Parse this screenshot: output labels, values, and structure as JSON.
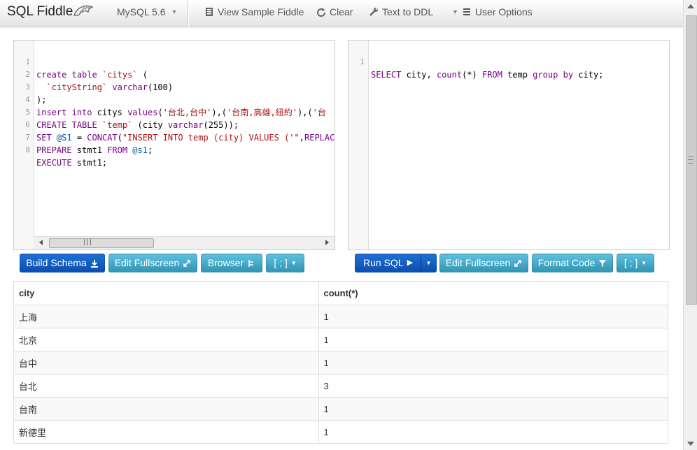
{
  "brand": {
    "title": "SQL Fiddle"
  },
  "nav": {
    "db_version": "MySQL 5.6",
    "view_sample": "View Sample Fiddle",
    "clear": "Clear",
    "text_to_ddl": "Text to DDL",
    "user_options": "User Options"
  },
  "schema_editor": {
    "line_numbers": [
      "1",
      "2",
      "3",
      "4",
      "5",
      "6",
      "7",
      "8"
    ],
    "lines": [
      "create table `citys` (",
      "  `cityString` varchar(100)",
      ");",
      "insert into citys values('台北,台中'),('台南,高雄,紐約'),('台",
      "CREATE TABLE `temp` (city varchar(255));",
      "SET @S1 = CONCAT(\"INSERT INTO temp (city) VALUES ('\",REPLAC",
      "PREPARE stmt1 FROM @s1;",
      "EXECUTE stmt1;"
    ]
  },
  "query_editor": {
    "line_numbers": [
      "1"
    ],
    "lines": [
      "SELECT city, count(*) FROM temp group by city;"
    ]
  },
  "schema_buttons": {
    "build": "Build Schema",
    "edit_fullscreen": "Edit Fullscreen",
    "browser": "Browser",
    "delimiter": "[ ; ]"
  },
  "query_buttons": {
    "run": "Run SQL",
    "edit_fullscreen": "Edit Fullscreen",
    "format": "Format Code",
    "delimiter": "[ ; ]"
  },
  "results": {
    "columns": [
      "city",
      "count(*)"
    ],
    "rows": [
      [
        "上海",
        "1"
      ],
      [
        "北京",
        "1"
      ],
      [
        "台中",
        "1"
      ],
      [
        "台北",
        "3"
      ],
      [
        "台南",
        "1"
      ],
      [
        "新德里",
        "1"
      ]
    ]
  },
  "colors": {
    "primary": "#0a4fb3",
    "info": "#2f96b4",
    "keyword": "#770088",
    "string": "#aa1111"
  }
}
